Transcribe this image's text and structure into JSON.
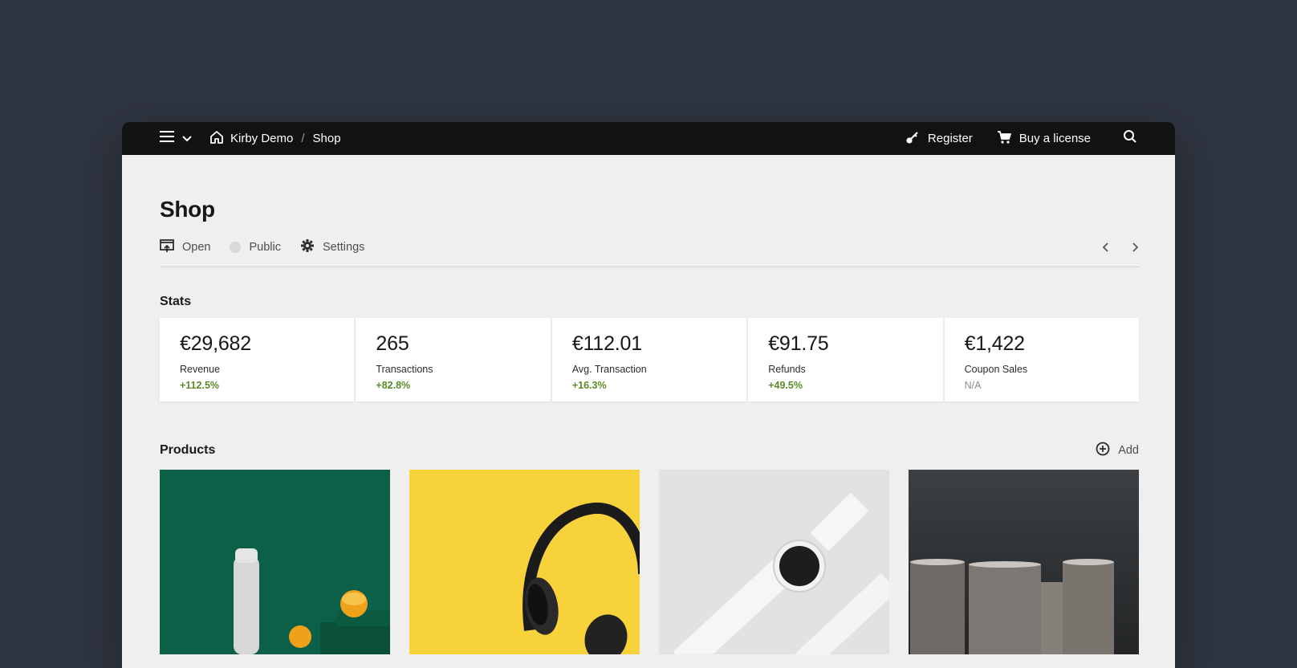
{
  "topbar": {
    "breadcrumb": [
      "Kirby Demo",
      "Shop"
    ],
    "register_label": "Register",
    "buy_label": "Buy a license"
  },
  "page": {
    "title": "Shop",
    "actions": {
      "open_label": "Open",
      "status_label": "Public",
      "settings_label": "Settings"
    }
  },
  "stats": {
    "label": "Stats",
    "items": [
      {
        "value": "€29,682",
        "label": "Revenue",
        "info": "+112.5%"
      },
      {
        "value": "265",
        "label": "Transactions",
        "info": "+82.8%"
      },
      {
        "value": "€112.01",
        "label": "Avg. Transaction",
        "info": "+16.3%"
      },
      {
        "value": "€91.75",
        "label": "Refunds",
        "info": "+49.5%"
      },
      {
        "value": "€1,422",
        "label": "Coupon Sales",
        "info": "N/A"
      }
    ]
  },
  "products": {
    "label": "Products",
    "add_label": "Add",
    "cards": [
      {
        "image": "white bottle and orange on green background"
      },
      {
        "image": "black headphones on yellow background"
      },
      {
        "image": "white smartwatch on light grey background"
      },
      {
        "image": "grey ceramic vases on dark background"
      }
    ]
  },
  "colors": {
    "page_background": "#2f3540",
    "topbar": "#111214",
    "panel": "#efefef",
    "positive": "#5b8b27"
  }
}
